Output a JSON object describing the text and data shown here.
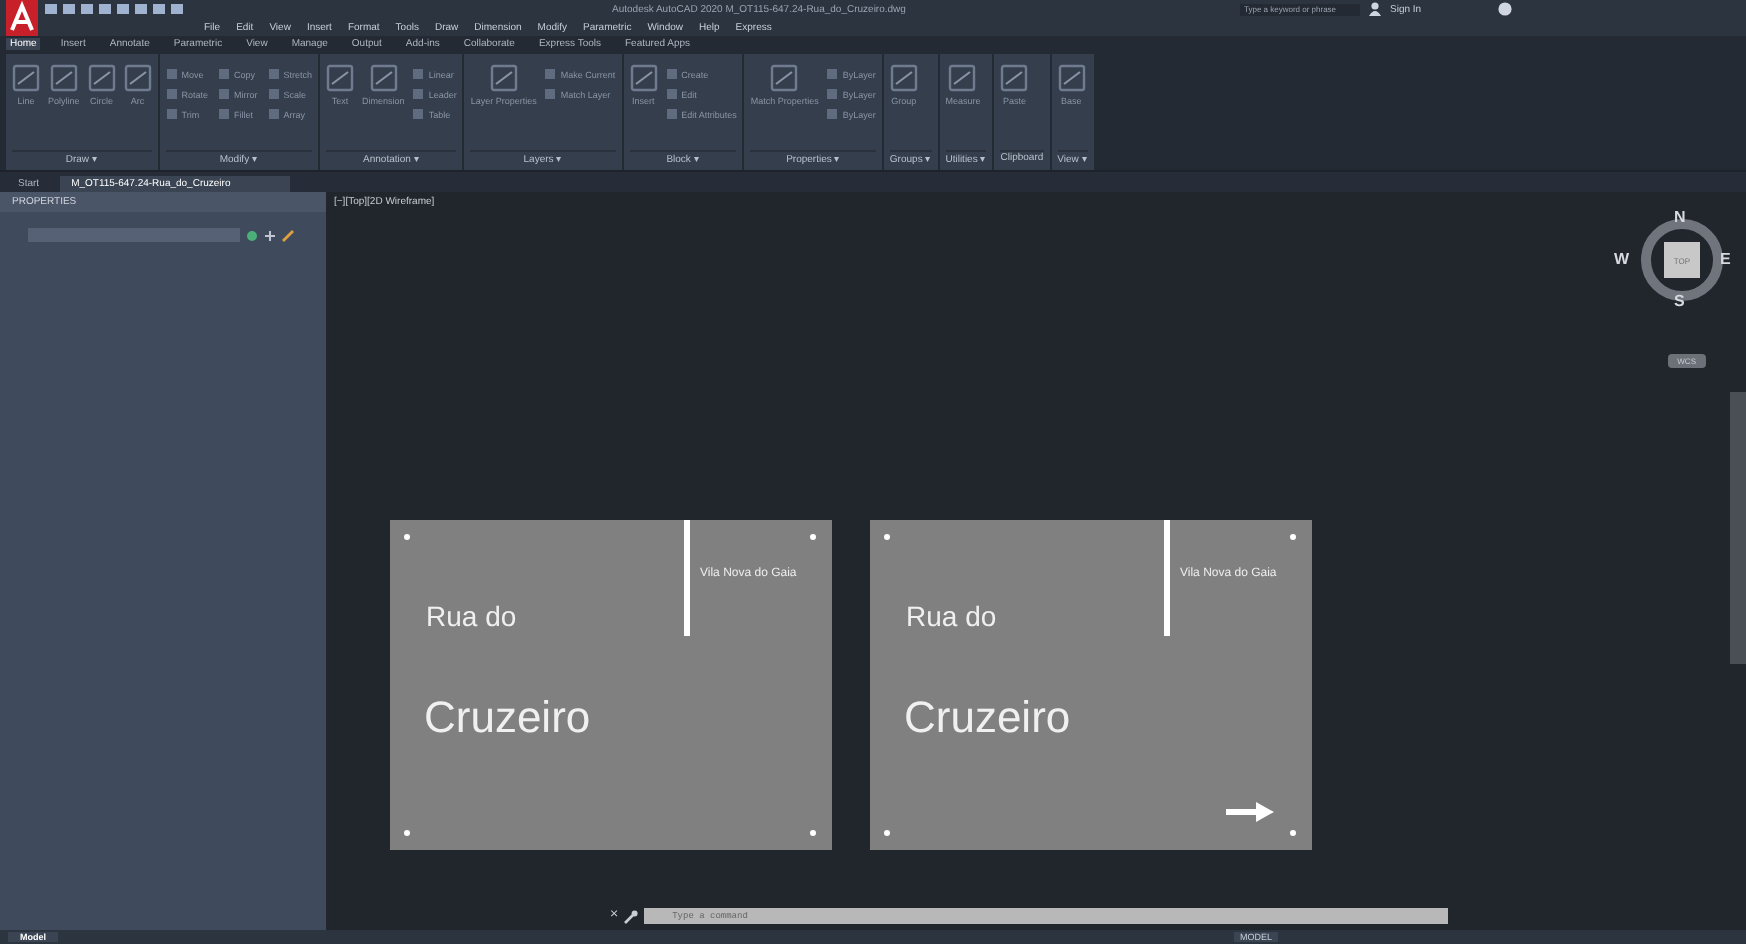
{
  "window": {
    "title": "Autodesk AutoCAD 2020   M_OT115-647.24-Rua_do_Cruzeiro.dwg",
    "search": {
      "placeholder": "Type a keyword or phrase"
    },
    "sign_in": "Sign In"
  },
  "menu": [
    "File",
    "Edit",
    "View",
    "Insert",
    "Format",
    "Tools",
    "Draw",
    "Dimension",
    "Modify",
    "Parametric",
    "Window",
    "Help",
    "Express"
  ],
  "ribbon_tabs": [
    {
      "label": "Home",
      "selected": true
    },
    {
      "label": "Insert",
      "selected": false
    },
    {
      "label": "Annotate",
      "selected": false
    },
    {
      "label": "Parametric",
      "selected": false
    },
    {
      "label": "View",
      "selected": false
    },
    {
      "label": "Manage",
      "selected": false
    },
    {
      "label": "Output",
      "selected": false
    },
    {
      "label": "Add-ins",
      "selected": false
    },
    {
      "label": "Collaborate",
      "selected": false
    },
    {
      "label": "Express Tools",
      "selected": false
    },
    {
      "label": "Featured Apps",
      "selected": false
    }
  ],
  "panels": [
    {
      "title": "Draw ▾",
      "large": [
        "Line",
        "Polyline",
        "Circle",
        "Arc"
      ]
    },
    {
      "title": "Modify ▾",
      "small": [
        "Move",
        "Rotate",
        "Trim",
        "Copy",
        "Mirror",
        "Fillet",
        "Stretch",
        "Scale",
        "Array"
      ]
    },
    {
      "title": "Annotation ▾",
      "large": [
        "Text",
        "Dimension"
      ],
      "small": [
        "Linear",
        "Leader",
        "Table"
      ]
    },
    {
      "title": "Layers ▾",
      "large": [
        "Layer Properties"
      ],
      "small": [
        "Make Current",
        "Match Layer"
      ]
    },
    {
      "title": "Block ▾",
      "large": [
        "Insert"
      ],
      "small": [
        "Create",
        "Edit",
        "Edit Attributes"
      ]
    },
    {
      "title": "Properties ▾",
      "large": [
        "Match Properties"
      ],
      "small": [
        "ByLayer",
        "ByLayer",
        "ByLayer"
      ]
    },
    {
      "title": "Groups ▾",
      "large": [
        "Group"
      ]
    },
    {
      "title": "Utilities ▾",
      "large": [
        "Measure"
      ]
    },
    {
      "title": "Clipboard",
      "large": [
        "Paste"
      ]
    },
    {
      "title": "View ▾",
      "large": [
        "Base"
      ]
    }
  ],
  "file_tabs": [
    {
      "label": "Start",
      "selected": false
    },
    {
      "label": "M_OT115-647.24-Rua_do_Cruzeiro",
      "selected": true
    }
  ],
  "properties": {
    "title": "PROPERTIES"
  },
  "viewport": {
    "label": "[−][Top][2D Wireframe]",
    "compass": {
      "north": "N",
      "south": "S",
      "west": "W",
      "east": "E",
      "view": "TOP",
      "ucs": "WCS"
    },
    "signs": [
      {
        "place": "Vila Nova do Gaia",
        "line1": "Rua do",
        "line2": "Cruzeiro",
        "arrow": false
      },
      {
        "place": "Vila Nova do Gaia",
        "line1": "Rua do",
        "line2": "Cruzeiro",
        "arrow": true
      }
    ]
  },
  "command_line": {
    "close": "×",
    "placeholder": "Type a command"
  },
  "status_bar": {
    "layout_tab": "Model",
    "mode": "MODEL"
  }
}
